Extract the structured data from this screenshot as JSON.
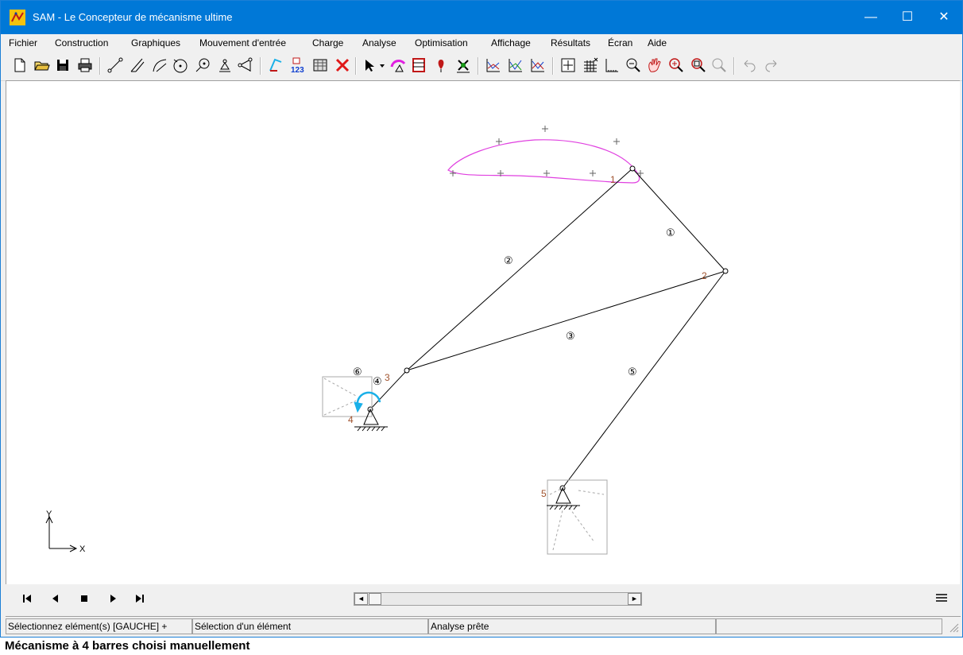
{
  "window": {
    "title": "SAM - Le Concepteur de mécanisme ultime",
    "controls": {
      "minimize": "—",
      "maximize": "☐",
      "close": "✕"
    }
  },
  "menu": {
    "items": [
      "Fichier",
      "Construction",
      "Graphiques",
      "Mouvement d'entrée",
      "Charge",
      "Analyse",
      "Optimisation",
      "Affichage",
      "Résultats",
      "Écran",
      "Aide"
    ]
  },
  "toolbar": {
    "icons": [
      "new-file-icon",
      "open-folder-icon",
      "save-icon",
      "print-icon",
      "beam-icon",
      "truss-icon",
      "arc-beam-icon",
      "circle-node-icon",
      "gear-icon",
      "fixed-support-icon",
      "slider-icon",
      "motion-curve-icon",
      "numbering-icon",
      "table-icon",
      "delete-icon",
      "select-arrow-icon",
      "dropdown-icon",
      "input-motion-icon",
      "load-icon",
      "force-icon",
      "analysis-icon",
      "chart-1-icon",
      "chart-2-icon",
      "chart-3-icon",
      "fit-view-icon",
      "grid-icon",
      "axes-icon",
      "zoom-out-icon",
      "pan-icon",
      "zoom-in-icon",
      "zoom-window-icon",
      "zoom-previous-icon",
      "undo-icon",
      "redo-icon"
    ]
  },
  "canvas": {
    "element_labels": [
      "①",
      "②",
      "③",
      "④",
      "⑤",
      "⑥"
    ],
    "node_labels": [
      "1",
      "2",
      "3",
      "4",
      "5"
    ],
    "axis_labels": {
      "x": "X",
      "y": "Y"
    },
    "colors": {
      "trajectory": "#e040e0",
      "link": "#000000",
      "rotation_arrow": "#1ab0e8",
      "node_label": "#a0522d",
      "support_box": "#a8a8a8"
    }
  },
  "playback": {
    "buttons": [
      "first-frame-icon",
      "previous-frame-icon",
      "stop-icon",
      "next-frame-icon",
      "last-frame-icon"
    ],
    "scroll_left": "◄",
    "scroll_right": "►"
  },
  "statusbar": {
    "pane1": "Sélectionnez elément(s) [GAUCHE] +",
    "pane2": "Sélection d'un élément",
    "pane3": "Analyse prête",
    "pane4": ""
  },
  "caption": "Mécanisme à 4 barres choisi manuellement"
}
